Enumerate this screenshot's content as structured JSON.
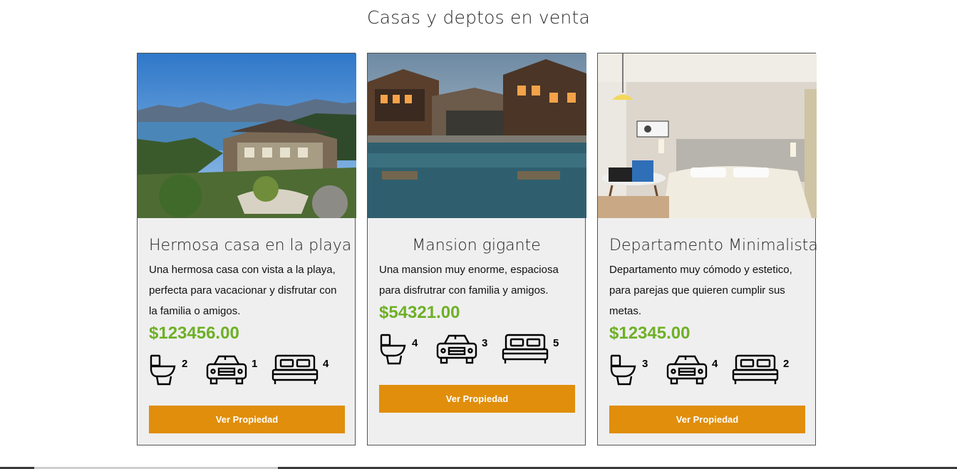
{
  "page": {
    "title": "Casas y deptos en venta"
  },
  "listings": [
    {
      "title": "Hermosa casa en la playa",
      "description": "Una hermosa casa con vista a la playa, perfecta para vacacionar y disfrutar con la familia o amigos.",
      "price": "$123456.00",
      "bathrooms": "2",
      "parking": "1",
      "bedrooms": "4",
      "button_label": "Ver Propiedad"
    },
    {
      "title": "Mansion gigante",
      "description": "Una mansion muy enorme, espaciosa para disfrutrar con familia y amigos.",
      "price": "$54321.00",
      "bathrooms": "4",
      "parking": "3",
      "bedrooms": "5",
      "button_label": "Ver Propiedad"
    },
    {
      "title": "Departamento Minimalista",
      "description": "Departamento muy cómodo y estetico, para parejas que quieren cumplir sus metas.",
      "price": "$12345.00",
      "bathrooms": "3",
      "parking": "4",
      "bedrooms": "2",
      "button_label": "Ver Propiedad"
    }
  ],
  "icons": {
    "bathroom": "toilet-icon",
    "parking": "car-icon",
    "bedroom": "bed-icon"
  },
  "colors": {
    "price": "#6eb026",
    "button": "#e08e0b",
    "card_bg": "#efefef"
  }
}
